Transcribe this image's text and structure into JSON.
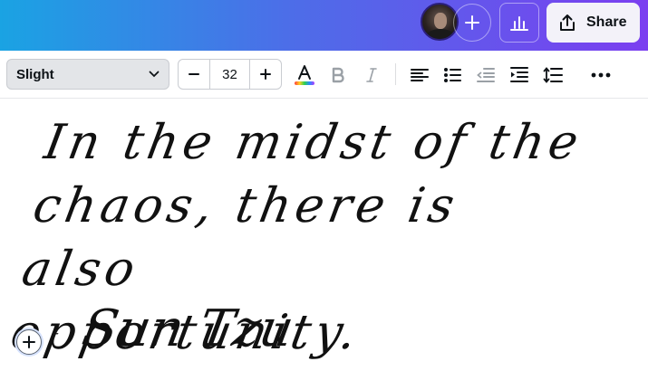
{
  "header": {
    "share_label": "Share",
    "icons": {
      "add_collaborator": "plus-icon",
      "statistics": "bar-chart-icon",
      "share": "upload-icon"
    }
  },
  "toolbar": {
    "font_family": "Slight",
    "font_size": "32",
    "text_color_icon": "text-color-icon",
    "tools": [
      "text-color-icon",
      "bold-icon",
      "italic-icon",
      "align-left-icon",
      "bullet-list-icon",
      "outdent-icon",
      "indent-icon",
      "line-spacing-icon",
      "more-icon"
    ]
  },
  "canvas": {
    "quote_lines": [
      "In the midst of the",
      "chaos, there is also",
      "opportunity."
    ],
    "attribution_dash": "-",
    "attribution": "Sun Tzu"
  },
  "colors": {
    "gradient_start": "#1aa3e3",
    "gradient_end": "#7b3ff0",
    "share_bg": "#f3f2f9"
  }
}
